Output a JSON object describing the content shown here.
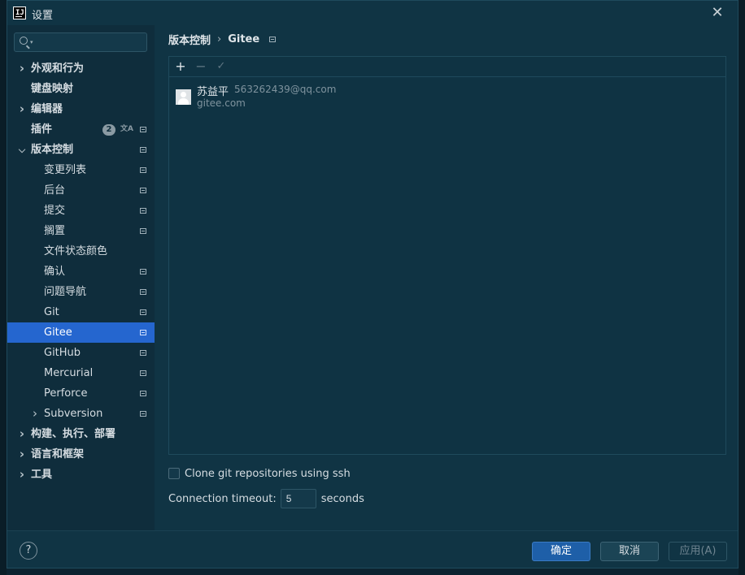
{
  "window": {
    "title": "设置",
    "close_symbol": "✕"
  },
  "sidebar": {
    "search_placeholder": "",
    "items": [
      {
        "label": "外观和行为",
        "expandable": true,
        "expanded": false,
        "level": 0,
        "bold": true,
        "pinned": false
      },
      {
        "label": "键盘映射",
        "expandable": false,
        "level": 0,
        "bold": true,
        "pinned": false
      },
      {
        "label": "编辑器",
        "expandable": true,
        "expanded": false,
        "level": 0,
        "bold": true,
        "pinned": false
      },
      {
        "label": "插件",
        "expandable": false,
        "level": 0,
        "bold": true,
        "pinned": true,
        "badge": "2"
      },
      {
        "label": "版本控制",
        "expandable": true,
        "expanded": true,
        "level": 0,
        "bold": true,
        "pinned": true
      },
      {
        "label": "变更列表",
        "level": 1,
        "pinned": true
      },
      {
        "label": "后台",
        "level": 1,
        "pinned": true
      },
      {
        "label": "提交",
        "level": 1,
        "pinned": true
      },
      {
        "label": "搁置",
        "level": 1,
        "pinned": true
      },
      {
        "label": "文件状态颜色",
        "level": 1,
        "pinned": false
      },
      {
        "label": "确认",
        "level": 1,
        "pinned": true
      },
      {
        "label": "问题导航",
        "level": 1,
        "pinned": true
      },
      {
        "label": "Git",
        "level": 1,
        "pinned": true
      },
      {
        "label": "Gitee",
        "level": 1,
        "pinned": true,
        "selected": true
      },
      {
        "label": "GitHub",
        "level": 1,
        "pinned": true
      },
      {
        "label": "Mercurial",
        "level": 1,
        "pinned": true
      },
      {
        "label": "Perforce",
        "level": 1,
        "pinned": true
      },
      {
        "label": "Subversion",
        "level": 1,
        "expandable": true,
        "expanded": false,
        "pinned": true
      },
      {
        "label": "构建、执行、部署",
        "expandable": true,
        "expanded": false,
        "level": 0,
        "bold": true,
        "pinned": false
      },
      {
        "label": "语言和框架",
        "expandable": true,
        "expanded": false,
        "level": 0,
        "bold": true,
        "pinned": false
      },
      {
        "label": "工具",
        "expandable": true,
        "expanded": false,
        "level": 0,
        "bold": true,
        "pinned": false
      }
    ]
  },
  "breadcrumb": {
    "parent": "版本控制",
    "separator": "›",
    "current": "Gitee"
  },
  "toolbar": {
    "add": "+",
    "remove": "−",
    "check": "✓"
  },
  "accounts": [
    {
      "name": "苏益平",
      "email": "563262439@qq.com",
      "server": "gitee.com"
    }
  ],
  "options": {
    "clone_ssh_label": "Clone git repositories using ssh",
    "clone_ssh_checked": false,
    "timeout_label": "Connection timeout:",
    "timeout_value": "5",
    "timeout_unit": "seconds"
  },
  "footer": {
    "help": "?",
    "ok": "确定",
    "cancel": "取消",
    "apply": "应用(A)"
  },
  "colors": {
    "selected_bg": "#2566cf",
    "ok_button": "#1e5fa8",
    "dialog_bg": "#103444"
  }
}
